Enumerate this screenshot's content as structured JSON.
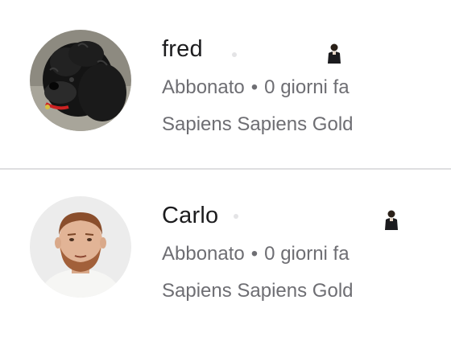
{
  "members": [
    {
      "name": "fred",
      "status": "Abbonato",
      "separator": "•",
      "time": "0 giorni fa",
      "plan": "Sapiens Sapiens Gold",
      "avatar_icon": "dog-avatar-icon"
    },
    {
      "name": "Carlo",
      "status": "Abbonato",
      "separator": "•",
      "time": "0 giorni fa",
      "plan": "Sapiens Sapiens Gold",
      "avatar_icon": "man-avatar-icon"
    }
  ],
  "colors": {
    "name_text": "#1c1c1e",
    "secondary_text": "#6e6e73",
    "divider": "#dedee0",
    "background": "#ffffff"
  }
}
